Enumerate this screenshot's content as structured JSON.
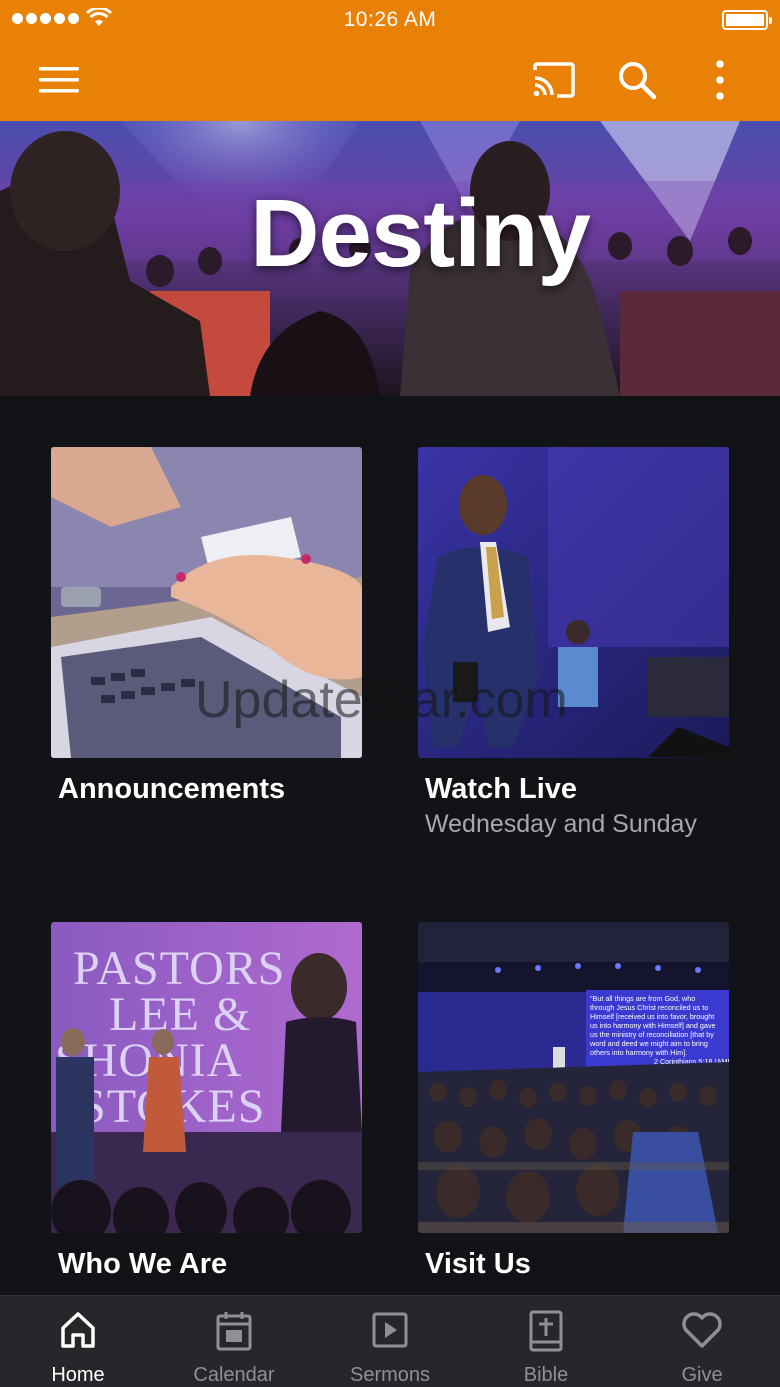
{
  "status_bar": {
    "time": "10:26 AM"
  },
  "app_bar": {
    "menu_icon": "hamburger-menu-icon",
    "cast_icon": "cast-icon",
    "search_icon": "search-icon",
    "more_icon": "more-vertical-icon",
    "background_color": "#e88106"
  },
  "hero": {
    "title": "Destiny"
  },
  "tiles": [
    {
      "title": "Announcements",
      "subtitle": ""
    },
    {
      "title": "Watch Live",
      "subtitle": "Wednesday and Sunday"
    },
    {
      "title": "Who We Are",
      "subtitle": "",
      "image_text": [
        "PASTORS",
        "LEE &",
        "SHONIA",
        "STOKES"
      ]
    },
    {
      "title": "Visit Us",
      "subtitle": "",
      "screen_text": [
        "\"But all things are from God, who",
        "through Jesus Christ reconciled us to",
        "Himself [received us into favor, brought",
        "us into harmony with Himself] and gave",
        "us the ministry of reconciliation [that by",
        "word and deed we might aim to bring",
        "others into harmony with Him].",
        "2 Corinthians 5:18 (AMP)"
      ]
    }
  ],
  "watermark": "UpdateStar.com",
  "bottom_nav": [
    {
      "label": "Home",
      "icon": "home-icon",
      "active": true
    },
    {
      "label": "Calendar",
      "icon": "calendar-icon",
      "active": false
    },
    {
      "label": "Sermons",
      "icon": "play-square-icon",
      "active": false
    },
    {
      "label": "Bible",
      "icon": "bible-icon",
      "active": false
    },
    {
      "label": "Give",
      "icon": "heart-icon",
      "active": false
    }
  ]
}
